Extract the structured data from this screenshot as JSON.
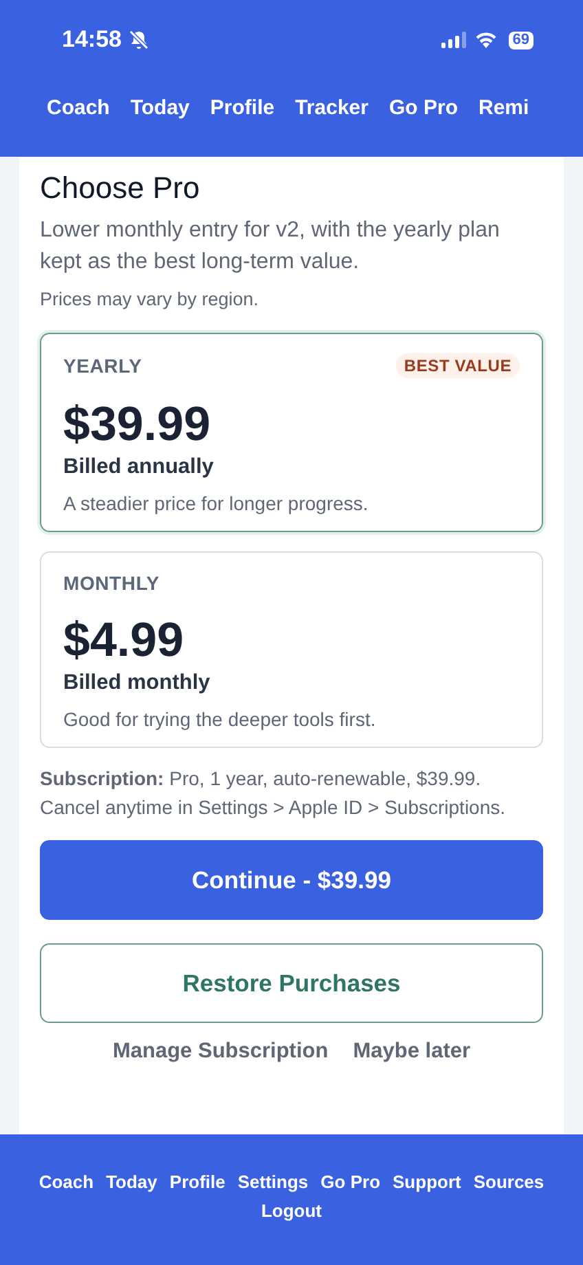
{
  "status_bar": {
    "time": "14:58",
    "battery": "69"
  },
  "top_nav": [
    "Coach",
    "Today",
    "Profile",
    "Tracker",
    "Go Pro",
    "Remi"
  ],
  "title": "Choose Pro",
  "subtitle": "Lower monthly entry for v2, with the yearly plan kept as the best long-term value.",
  "note": "Prices may vary by region.",
  "plans": [
    {
      "name": "YEARLY",
      "badge": "BEST VALUE",
      "price": "$39.99",
      "billing": "Billed annually",
      "description": "A steadier price for longer progress.",
      "selected": true
    },
    {
      "name": "MONTHLY",
      "price": "$4.99",
      "billing": "Billed monthly",
      "description": "Good for trying the deeper tools first.",
      "selected": false
    }
  ],
  "disclosure": "**Subscription:** Pro, 1 year, auto-renewable, $39.99. Cancel anytime in Settings > Apple ID > Subscriptions.",
  "continue_button": "Continue - $39.99",
  "restore_button": "Restore Purchases",
  "links": [
    "Manage Subscription",
    "Maybe later"
  ],
  "bottom_nav": [
    "Coach",
    "Today",
    "Profile",
    "Settings",
    "Go Pro",
    "Support",
    "Sources",
    "Logout"
  ]
}
